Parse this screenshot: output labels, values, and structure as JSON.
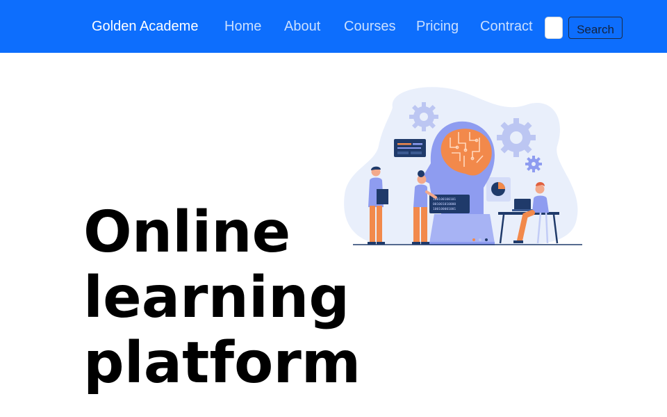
{
  "navbar": {
    "brand": "Golden Academe",
    "links": [
      {
        "label": "Home"
      },
      {
        "label": "About"
      },
      {
        "label": "Courses"
      },
      {
        "label": "Pricing"
      },
      {
        "label": "Contract"
      }
    ],
    "search": {
      "placeholder": "",
      "value": "",
      "button_label": "Search"
    }
  },
  "hero": {
    "title_lines": [
      "Online",
      "learning",
      "platform"
    ]
  },
  "illustration": {
    "icon": "ai-brain-learning-illustration",
    "screen_text": [
      "100100100101",
      "001001010000",
      "100100001001"
    ]
  },
  "colors": {
    "navbar_bg": "#0d6efd",
    "hero_text": "#000000",
    "illustration_blue": "#8e9cf0",
    "illustration_orange": "#f2894b",
    "illustration_navy": "#1f3a6a"
  }
}
